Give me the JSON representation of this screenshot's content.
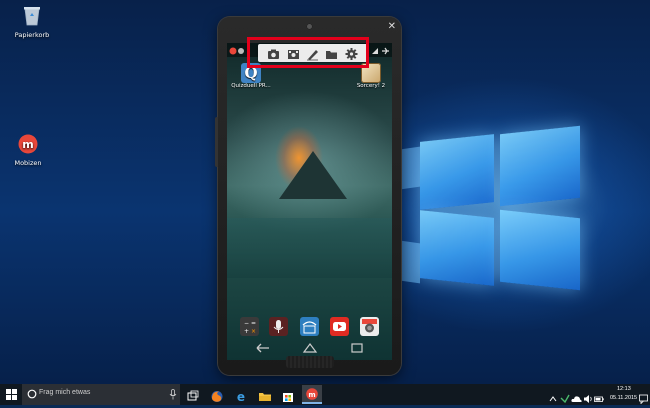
{
  "desktop": {
    "icons": [
      {
        "label": "Papierkorb",
        "icon": "recycle-bin-icon"
      },
      {
        "label": "Mobizen",
        "icon": "mobizen-app-icon"
      }
    ]
  },
  "phone_window": {
    "close_glyph": "✕",
    "toolbar": {
      "buttons": [
        "camera-icon",
        "video-record-icon",
        "pen-icon",
        "folder-icon",
        "gear-icon"
      ]
    },
    "apps": [
      {
        "label": "Quizduell PR...",
        "tile_letter": "Q"
      },
      {
        "label": "Sorcery! 2"
      }
    ],
    "dock": [
      "calculator-icon",
      "voice-recorder-icon",
      "store-icon",
      "youtube-icon",
      "camera-app-icon"
    ],
    "navbar": [
      "back-icon",
      "home-icon",
      "recents-icon"
    ]
  },
  "taskbar": {
    "search_placeholder": "Frag mich etwas",
    "pinned": [
      "task-view-icon",
      "firefox-icon",
      "edge-icon",
      "file-explorer-icon",
      "store-icon",
      "mobizen-taskbar-icon"
    ],
    "clock_time": "12:13",
    "clock_date": "05.11.2015"
  },
  "colors": {
    "highlight": "#e3001b",
    "mobizen_red": "#e8473a"
  }
}
